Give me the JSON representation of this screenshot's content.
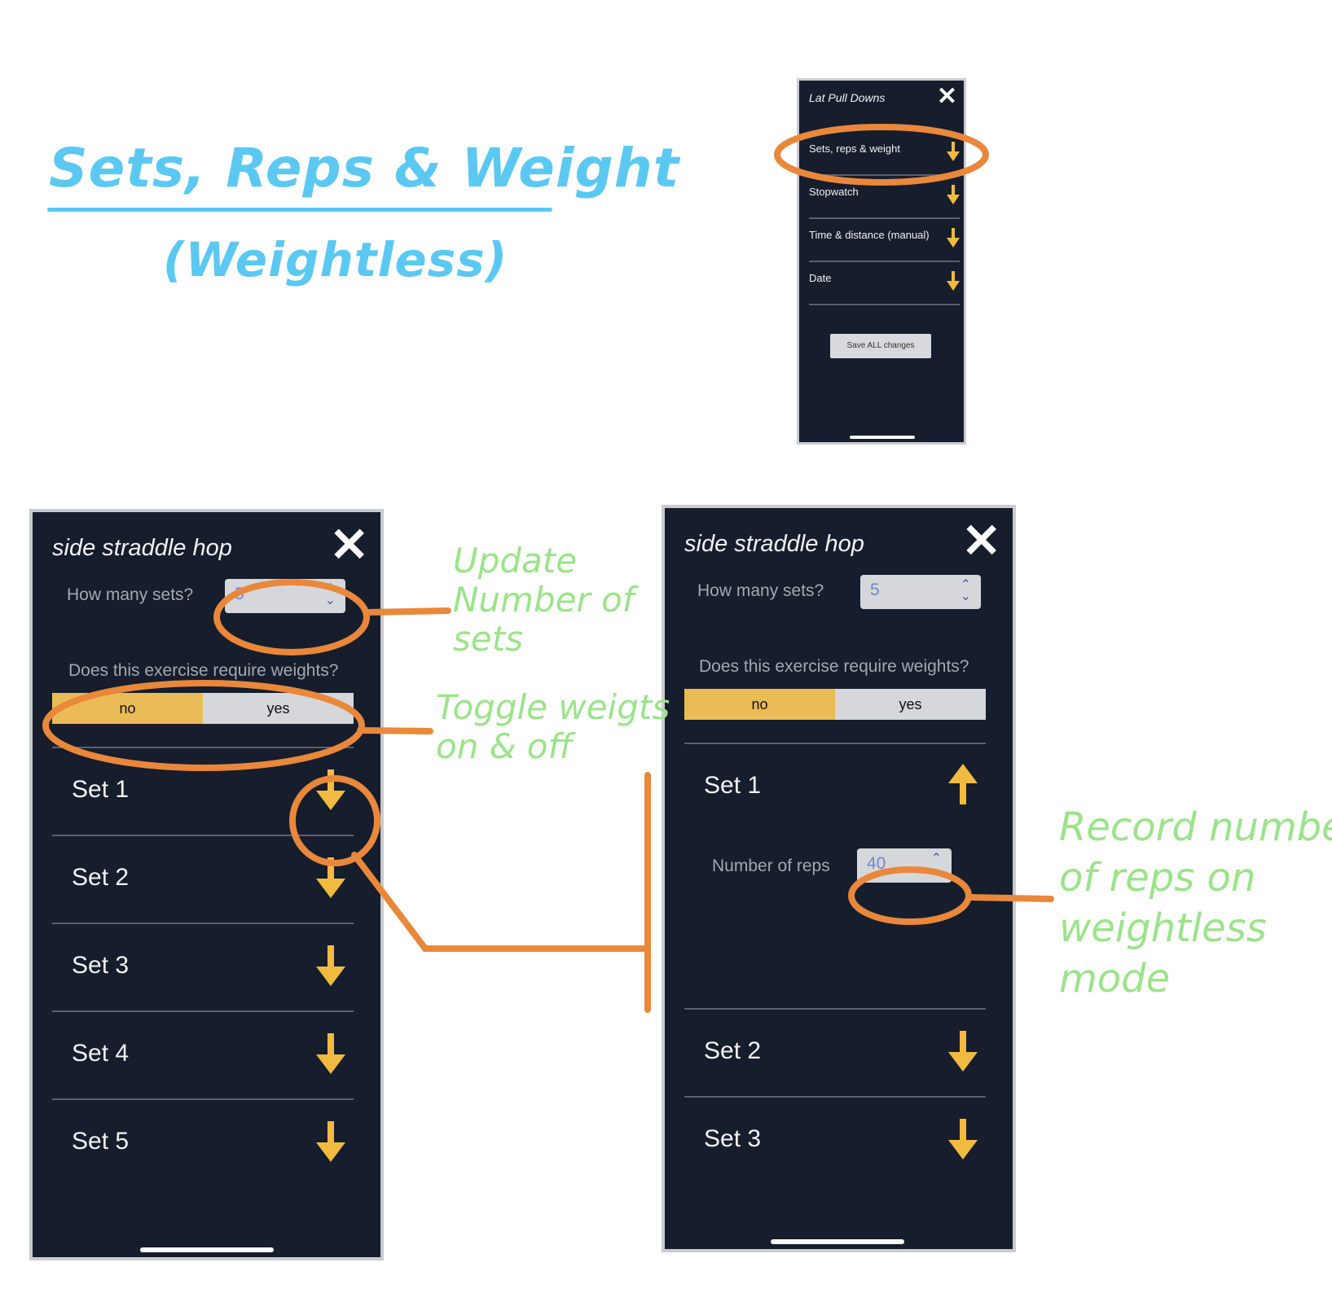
{
  "title": {
    "main": "Sets, Reps & Weight",
    "sub": "(Weightless)"
  },
  "notes": {
    "update_sets": "Update\nNumber of\nsets",
    "toggle_weights": "Toggle weigts\non & off",
    "record_reps": "Record number\nof reps on\nweightless\nmode"
  },
  "top_phone": {
    "title": "Lat Pull Downs",
    "close_icon": "close-icon",
    "menu": [
      {
        "label": "Sets, reps & weight",
        "icon": "arrow-down-icon"
      },
      {
        "label": "Stopwatch",
        "icon": "arrow-down-icon"
      },
      {
        "label": "Time & distance (manual)",
        "icon": "arrow-down-icon"
      },
      {
        "label": "Date",
        "icon": "arrow-down-icon"
      }
    ],
    "save_button": "Save ALL changes"
  },
  "left_phone": {
    "title": "side straddle hop",
    "sets_question": "How many sets?",
    "sets_value": "5",
    "weights_question": "Does this exercise require weights?",
    "toggle": {
      "no": "no",
      "yes": "yes",
      "selected": "no"
    },
    "sets": [
      "Set 1",
      "Set 2",
      "Set 3",
      "Set 4",
      "Set 5"
    ]
  },
  "right_phone": {
    "title": "side straddle hop",
    "sets_question": "How many sets?",
    "sets_value": "5",
    "weights_question": "Does this exercise require weights?",
    "toggle": {
      "no": "no",
      "yes": "yes",
      "selected": "no"
    },
    "expanded_set": {
      "label": "Set 1",
      "reps_label": "Number of reps",
      "reps_value": "40"
    },
    "sets": [
      "Set 2",
      "Set 3"
    ]
  },
  "colors": {
    "accent_orange": "#e9883b",
    "arrow_yellow": "#f0bb3e",
    "title_blue": "#5bc8f2",
    "note_green": "#9be38a",
    "panel_bg": "#161d2c"
  }
}
